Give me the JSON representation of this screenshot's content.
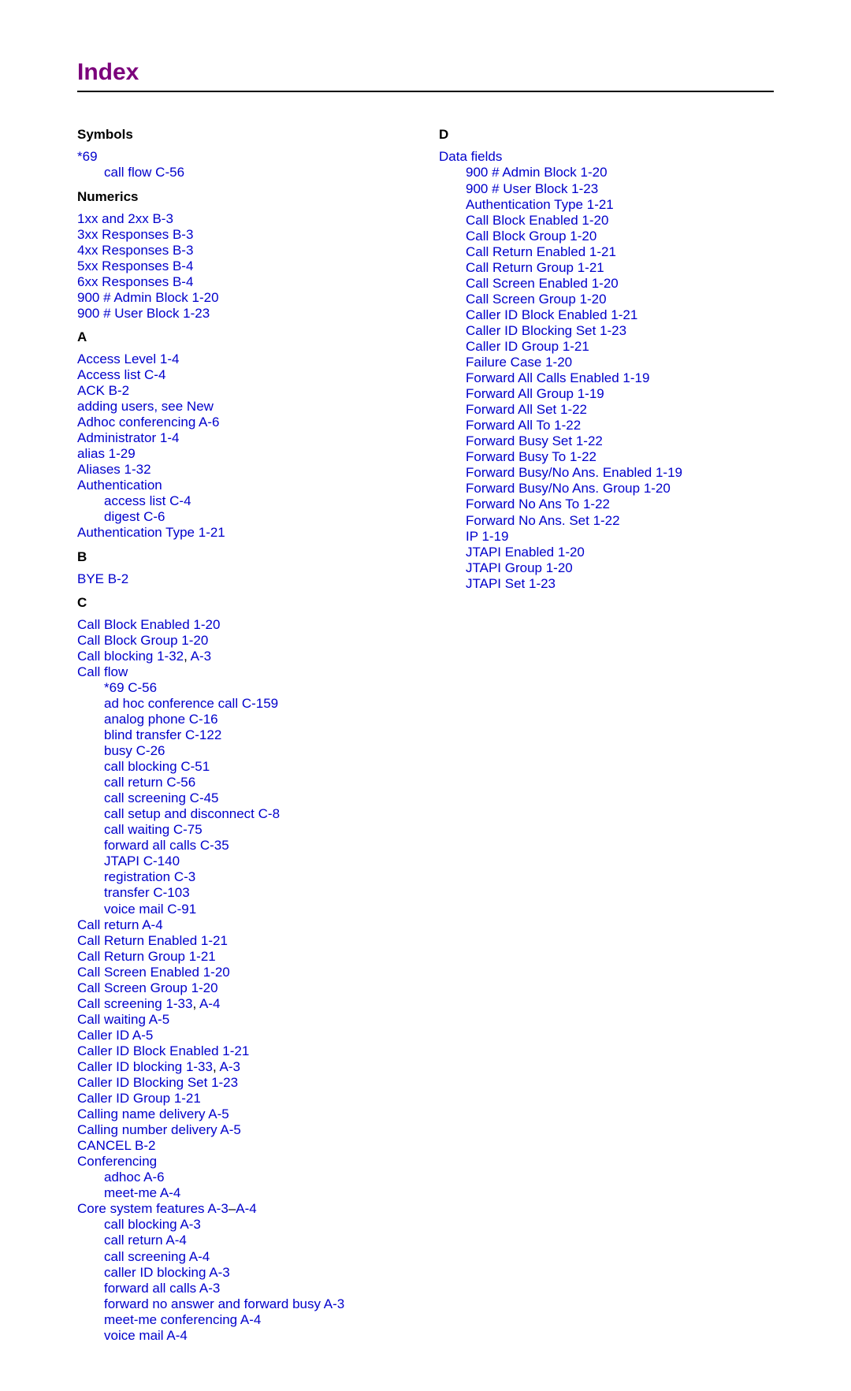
{
  "title": "Index",
  "sections": [
    {
      "head": "Symbols",
      "items": [
        {
          "text": "*69"
        },
        {
          "text": "call flow  C-56",
          "sub": true
        }
      ]
    },
    {
      "head": "Numerics",
      "items": [
        {
          "text": "1xx and 2xx  B-3"
        },
        {
          "text": "3xx Responses  B-3"
        },
        {
          "text": "4xx Responses  B-3"
        },
        {
          "text": "5xx Responses  B-4"
        },
        {
          "text": "6xx Responses  B-4"
        },
        {
          "text": "900 # Admin Block  1-20"
        },
        {
          "text": "900 # User Block  1-23"
        }
      ]
    },
    {
      "head": "A",
      "items": [
        {
          "text": "Access Level  1-4"
        },
        {
          "text": "Access list  C-4"
        },
        {
          "text": "ACK  B-2"
        },
        {
          "text": "adding users, see New"
        },
        {
          "text": "Adhoc conferencing  A-6"
        },
        {
          "text": "Administrator  1-4"
        },
        {
          "text": "alias  1-29"
        },
        {
          "text": "Aliases  1-32"
        },
        {
          "text": "Authentication"
        },
        {
          "text": "access list  C-4",
          "sub": true
        },
        {
          "text": "digest  C-6",
          "sub": true
        },
        {
          "text": "Authentication Type  1-21"
        }
      ]
    },
    {
      "head": "B",
      "items": [
        {
          "text": "BYE  B-2"
        }
      ]
    },
    {
      "head": "C",
      "items": [
        {
          "text": "Call Block Enabled  1-20"
        },
        {
          "text": "Call Block Group  1-20"
        },
        {
          "parts": [
            "Call blocking  1-32",
            "A-3"
          ]
        },
        {
          "text": "Call flow"
        },
        {
          "text": "*69  C-56",
          "sub": true
        },
        {
          "text": "ad hoc conference call  C-159",
          "sub": true
        },
        {
          "text": "analog phone  C-16",
          "sub": true
        },
        {
          "text": "blind transfer  C-122",
          "sub": true
        },
        {
          "text": "busy  C-26",
          "sub": true
        },
        {
          "text": "call blocking  C-51",
          "sub": true
        },
        {
          "text": "call return  C-56",
          "sub": true
        },
        {
          "text": "call screening  C-45",
          "sub": true
        },
        {
          "text": "call setup and disconnect  C-8",
          "sub": true
        },
        {
          "text": "call waiting  C-75",
          "sub": true
        },
        {
          "text": "forward all calls  C-35",
          "sub": true
        },
        {
          "text": "JTAPI  C-140",
          "sub": true
        },
        {
          "text": "registration  C-3",
          "sub": true
        },
        {
          "text": "transfer  C-103",
          "sub": true
        },
        {
          "text": "voice mail  C-91",
          "sub": true
        },
        {
          "text": "Call return  A-4"
        },
        {
          "text": "Call Return Enabled  1-21"
        },
        {
          "text": "Call Return Group  1-21"
        },
        {
          "text": "Call Screen Enabled  1-20"
        },
        {
          "text": "Call Screen Group  1-20"
        },
        {
          "parts": [
            "Call screening  1-33",
            "A-4"
          ]
        },
        {
          "text": "Call waiting  A-5"
        },
        {
          "text": "Caller ID  A-5"
        },
        {
          "text": "Caller ID Block Enabled  1-21"
        },
        {
          "parts": [
            "Caller ID blocking  1-33",
            "A-3"
          ]
        },
        {
          "text": "Caller ID Blocking Set  1-23"
        },
        {
          "text": "Caller ID Group  1-21"
        },
        {
          "text": "Calling name delivery  A-5"
        },
        {
          "text": "Calling number delivery  A-5"
        },
        {
          "text": "CANCEL  B-2"
        },
        {
          "text": "Conferencing"
        },
        {
          "text": "adhoc  A-6",
          "sub": true
        },
        {
          "text": "meet-me  A-4",
          "sub": true
        },
        {
          "rangeParts": [
            "Core system features  A-3",
            "A-4"
          ]
        },
        {
          "text": "call blocking  A-3",
          "sub": true
        },
        {
          "text": "call return  A-4",
          "sub": true
        },
        {
          "text": "call screening  A-4",
          "sub": true
        },
        {
          "text": "caller ID blocking  A-3",
          "sub": true
        },
        {
          "text": "forward all calls  A-3",
          "sub": true
        },
        {
          "text": "forward no answer and forward busy  A-3",
          "sub": true
        },
        {
          "text": "meet-me conferencing  A-4",
          "sub": true
        },
        {
          "text": "voice mail  A-4",
          "sub": true
        }
      ]
    },
    {
      "head": "D",
      "items": [
        {
          "text": "Data fields"
        },
        {
          "text": "900 # Admin Block  1-20",
          "sub": true
        },
        {
          "text": "900 # User Block  1-23",
          "sub": true
        },
        {
          "text": "Authentication Type  1-21",
          "sub": true
        },
        {
          "text": "Call Block Enabled  1-20",
          "sub": true
        },
        {
          "text": "Call Block Group  1-20",
          "sub": true
        },
        {
          "text": "Call Return Enabled  1-21",
          "sub": true
        },
        {
          "text": "Call Return Group  1-21",
          "sub": true
        },
        {
          "text": "Call Screen Enabled  1-20",
          "sub": true
        },
        {
          "text": "Call Screen Group  1-20",
          "sub": true
        },
        {
          "text": "Caller ID Block Enabled  1-21",
          "sub": true
        },
        {
          "text": "Caller ID Blocking Set  1-23",
          "sub": true
        },
        {
          "text": "Caller ID Group  1-21",
          "sub": true
        },
        {
          "text": "Failure Case  1-20",
          "sub": true
        },
        {
          "text": "Forward All Calls Enabled  1-19",
          "sub": true
        },
        {
          "text": "Forward All Group  1-19",
          "sub": true
        },
        {
          "text": "Forward All Set  1-22",
          "sub": true
        },
        {
          "text": "Forward All To  1-22",
          "sub": true
        },
        {
          "text": "Forward Busy Set  1-22",
          "sub": true
        },
        {
          "text": "Forward Busy To  1-22",
          "sub": true
        },
        {
          "text": "Forward Busy/No Ans. Enabled  1-19",
          "sub": true
        },
        {
          "text": "Forward Busy/No Ans. Group  1-20",
          "sub": true
        },
        {
          "text": "Forward No Ans To  1-22",
          "sub": true
        },
        {
          "text": "Forward No Ans. Set  1-22",
          "sub": true
        },
        {
          "text": "IP  1-19",
          "sub": true
        },
        {
          "text": "JTAPI Enabled  1-20",
          "sub": true
        },
        {
          "text": "JTAPI Group  1-20",
          "sub": true
        },
        {
          "text": "JTAPI Set  1-23",
          "sub": true
        }
      ]
    }
  ]
}
